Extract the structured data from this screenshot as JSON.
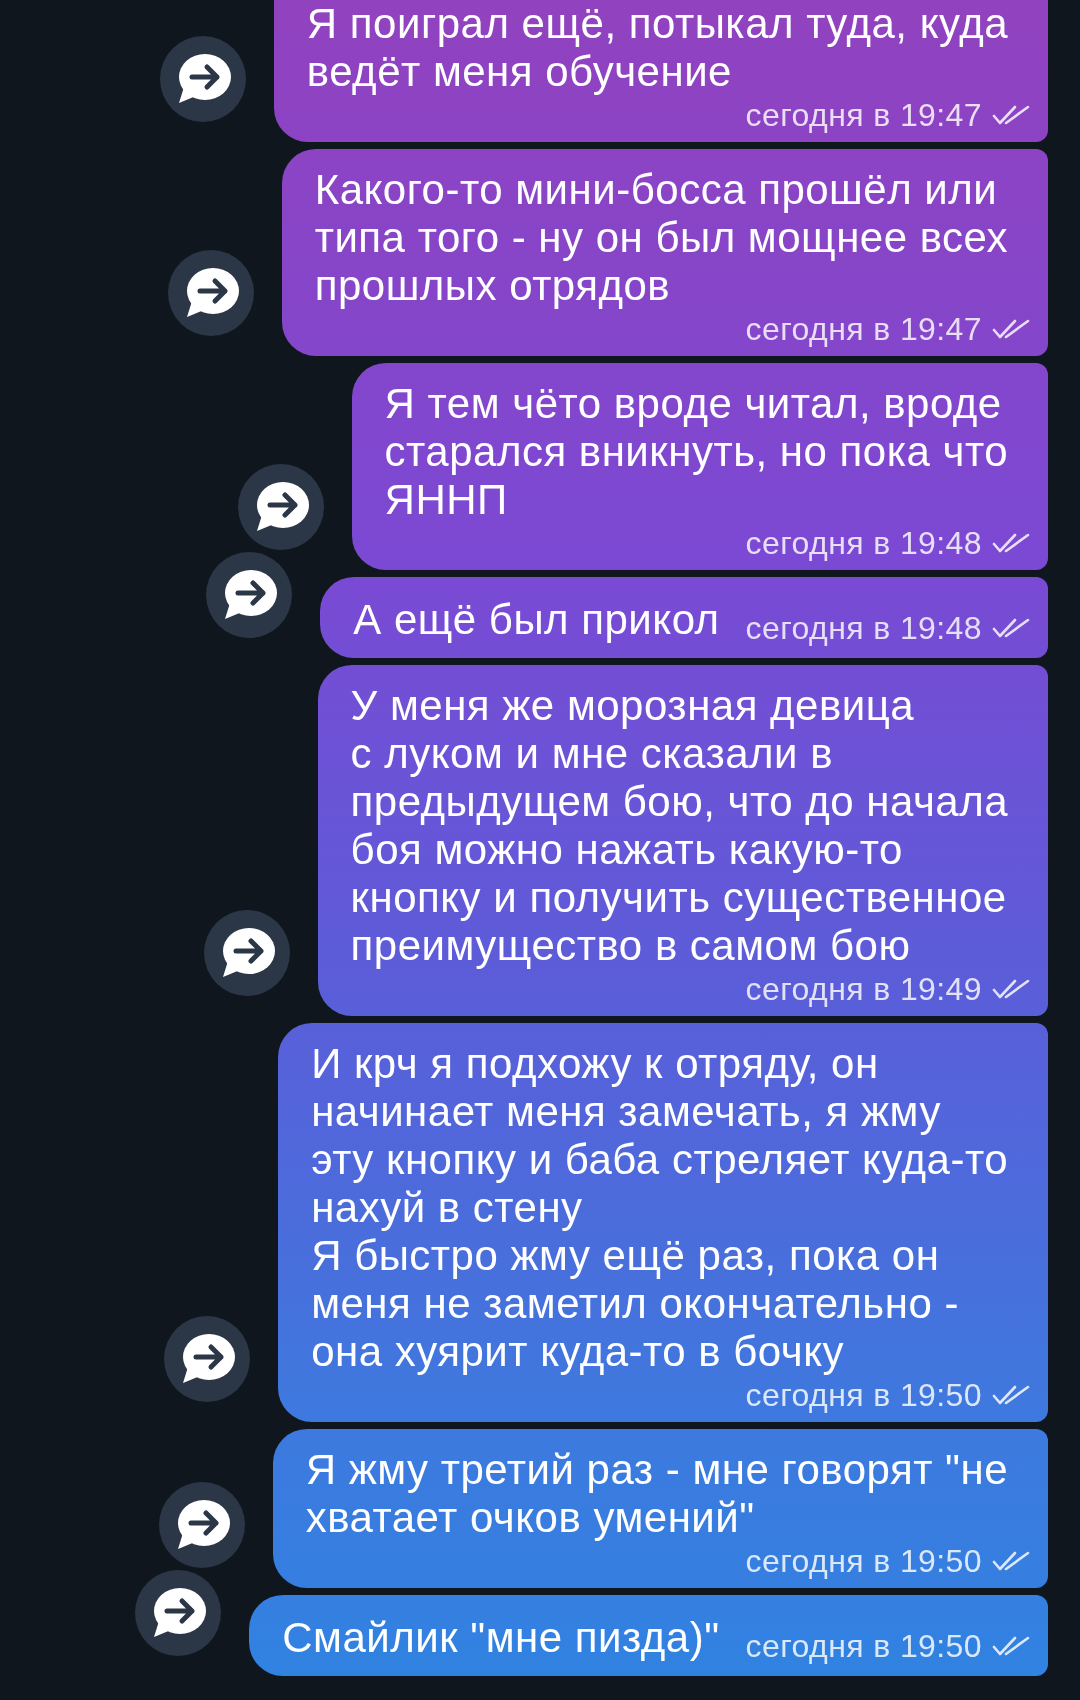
{
  "messages": [
    {
      "text": "Я поиграл ещё, потыкал туда, куда\nведёт меня обучение",
      "time": "сегодня в 19:47",
      "read": true
    },
    {
      "text": "Какого-то мини-босса прошёл или\nтипа того - ну он был мощнее всех\nпрошлых отрядов",
      "time": "сегодня в 19:47",
      "read": true
    },
    {
      "text": "Я тем чёто вроде читал, вроде\nстарался вникнуть, но пока что\nЯННП",
      "time": "сегодня в 19:48",
      "read": true
    },
    {
      "text": "А ещё был прикол",
      "time": "сегодня в 19:48",
      "read": true
    },
    {
      "text": "У меня же морозная девица\nс луком и мне сказали в\nпредыдущем бою, что до начала\nбоя можно нажать какую-то\nкнопку и получить существенное\nпреимущество в самом бою",
      "time": "сегодня в 19:49",
      "read": true
    },
    {
      "text": "И крч я подхожу к отряду, он\nначинает меня замечать, я жму\nэту кнопку и баба стреляет куда-то\nнахуй в стену\nЯ быстро жму ещё раз, пока он\nменя не заметил окончательно -\nона хуярит куда-то в бочку",
      "time": "сегодня в 19:50",
      "read": true
    },
    {
      "text": "Я жму третий раз - мне говорят \"не\nхватает очков умений\"",
      "time": "сегодня в 19:50",
      "read": true
    },
    {
      "text": "Смайлик \"мне пизда)\"",
      "time": "сегодня в 19:50",
      "read": true
    }
  ]
}
